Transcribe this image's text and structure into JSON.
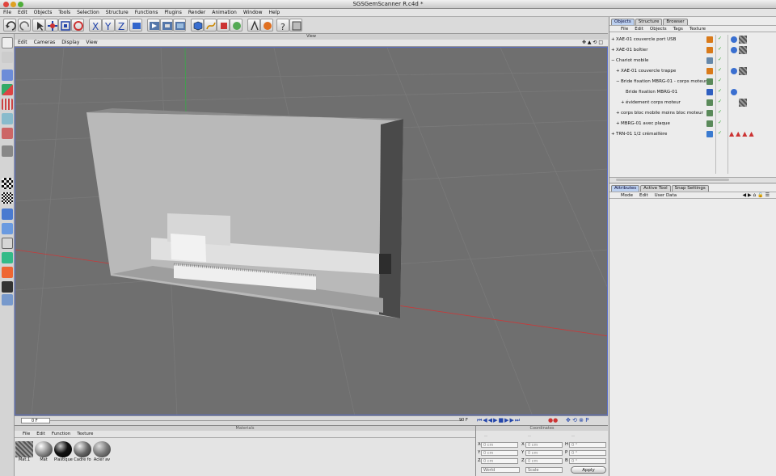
{
  "window": {
    "title": "SGSGemScanner R.c4d *"
  },
  "menubar": [
    "File",
    "Edit",
    "Objects",
    "Tools",
    "Selection",
    "Structure",
    "Functions",
    "Plugins",
    "Render",
    "Animation",
    "Window",
    "Help"
  ],
  "viewport": {
    "header": "View",
    "menu": [
      "Edit",
      "Cameras",
      "Display",
      "View"
    ]
  },
  "timeline": {
    "current": "0 F",
    "end": "90 F"
  },
  "materials": {
    "header": "Materials",
    "menu": [
      "File",
      "Edit",
      "Function",
      "Texture"
    ],
    "items": [
      {
        "label": "Mat.1"
      },
      {
        "label": "Mat"
      },
      {
        "label": "Plastique"
      },
      {
        "label": "Cadre fo"
      },
      {
        "label": "Acier av"
      }
    ]
  },
  "coordinates": {
    "header": "Coordinates",
    "top": [
      "--",
      "--",
      "--"
    ],
    "rows": [
      {
        "a": "X",
        "av": "0 cm",
        "b": "X",
        "bv": "0 cm",
        "c": "H",
        "cv": "0 °"
      },
      {
        "a": "Y",
        "av": "0 cm",
        "b": "Y",
        "bv": "0 cm",
        "c": "P",
        "cv": "0 °"
      },
      {
        "a": "Z",
        "av": "0 cm",
        "b": "Z",
        "bv": "0 cm",
        "c": "B",
        "cv": "0 °"
      }
    ],
    "mode": "World",
    "scale": "Scale",
    "apply": "Apply"
  },
  "object_manager": {
    "tabs": [
      "Objects",
      "Structure",
      "Browser"
    ],
    "menu": [
      "File",
      "Edit",
      "Objects",
      "Tags",
      "Texture"
    ],
    "objects": [
      {
        "label": "XAE-01 couvercle port USB",
        "indent": 0,
        "exp": "+"
      },
      {
        "label": "XAE-01 boîtier",
        "indent": 0,
        "exp": "+"
      },
      {
        "label": "Chariot mobile",
        "indent": 0,
        "exp": "−"
      },
      {
        "label": "XAE-01 couvercle trappe",
        "indent": 1,
        "exp": "+"
      },
      {
        "label": "Bride fixation MBRG-01 - corps moteur",
        "indent": 1,
        "exp": "−"
      },
      {
        "label": "Bride fixation MBRG-01",
        "indent": 2,
        "exp": ""
      },
      {
        "label": "évidement corps moteur",
        "indent": 2,
        "exp": "+"
      },
      {
        "label": "corps bloc mobile moins bloc moteur",
        "indent": 1,
        "exp": "+"
      },
      {
        "label": "MBRG-01 avec plaque",
        "indent": 1,
        "exp": "+"
      },
      {
        "label": "TRN-01 1/2 crémaillère",
        "indent": 0,
        "exp": "+"
      }
    ]
  },
  "attribute_manager": {
    "tabs": [
      "Attributes",
      "Active Tool",
      "Snap Settings"
    ],
    "menu": [
      "Mode",
      "Edit",
      "User Data"
    ]
  },
  "colors": {
    "viewport_bg": "#6f6f6f",
    "axis_x": "#c83a3a",
    "axis_y": "#3aa84a",
    "axis_z": "#4455cc",
    "selected_tab": "#bcd0ef"
  }
}
